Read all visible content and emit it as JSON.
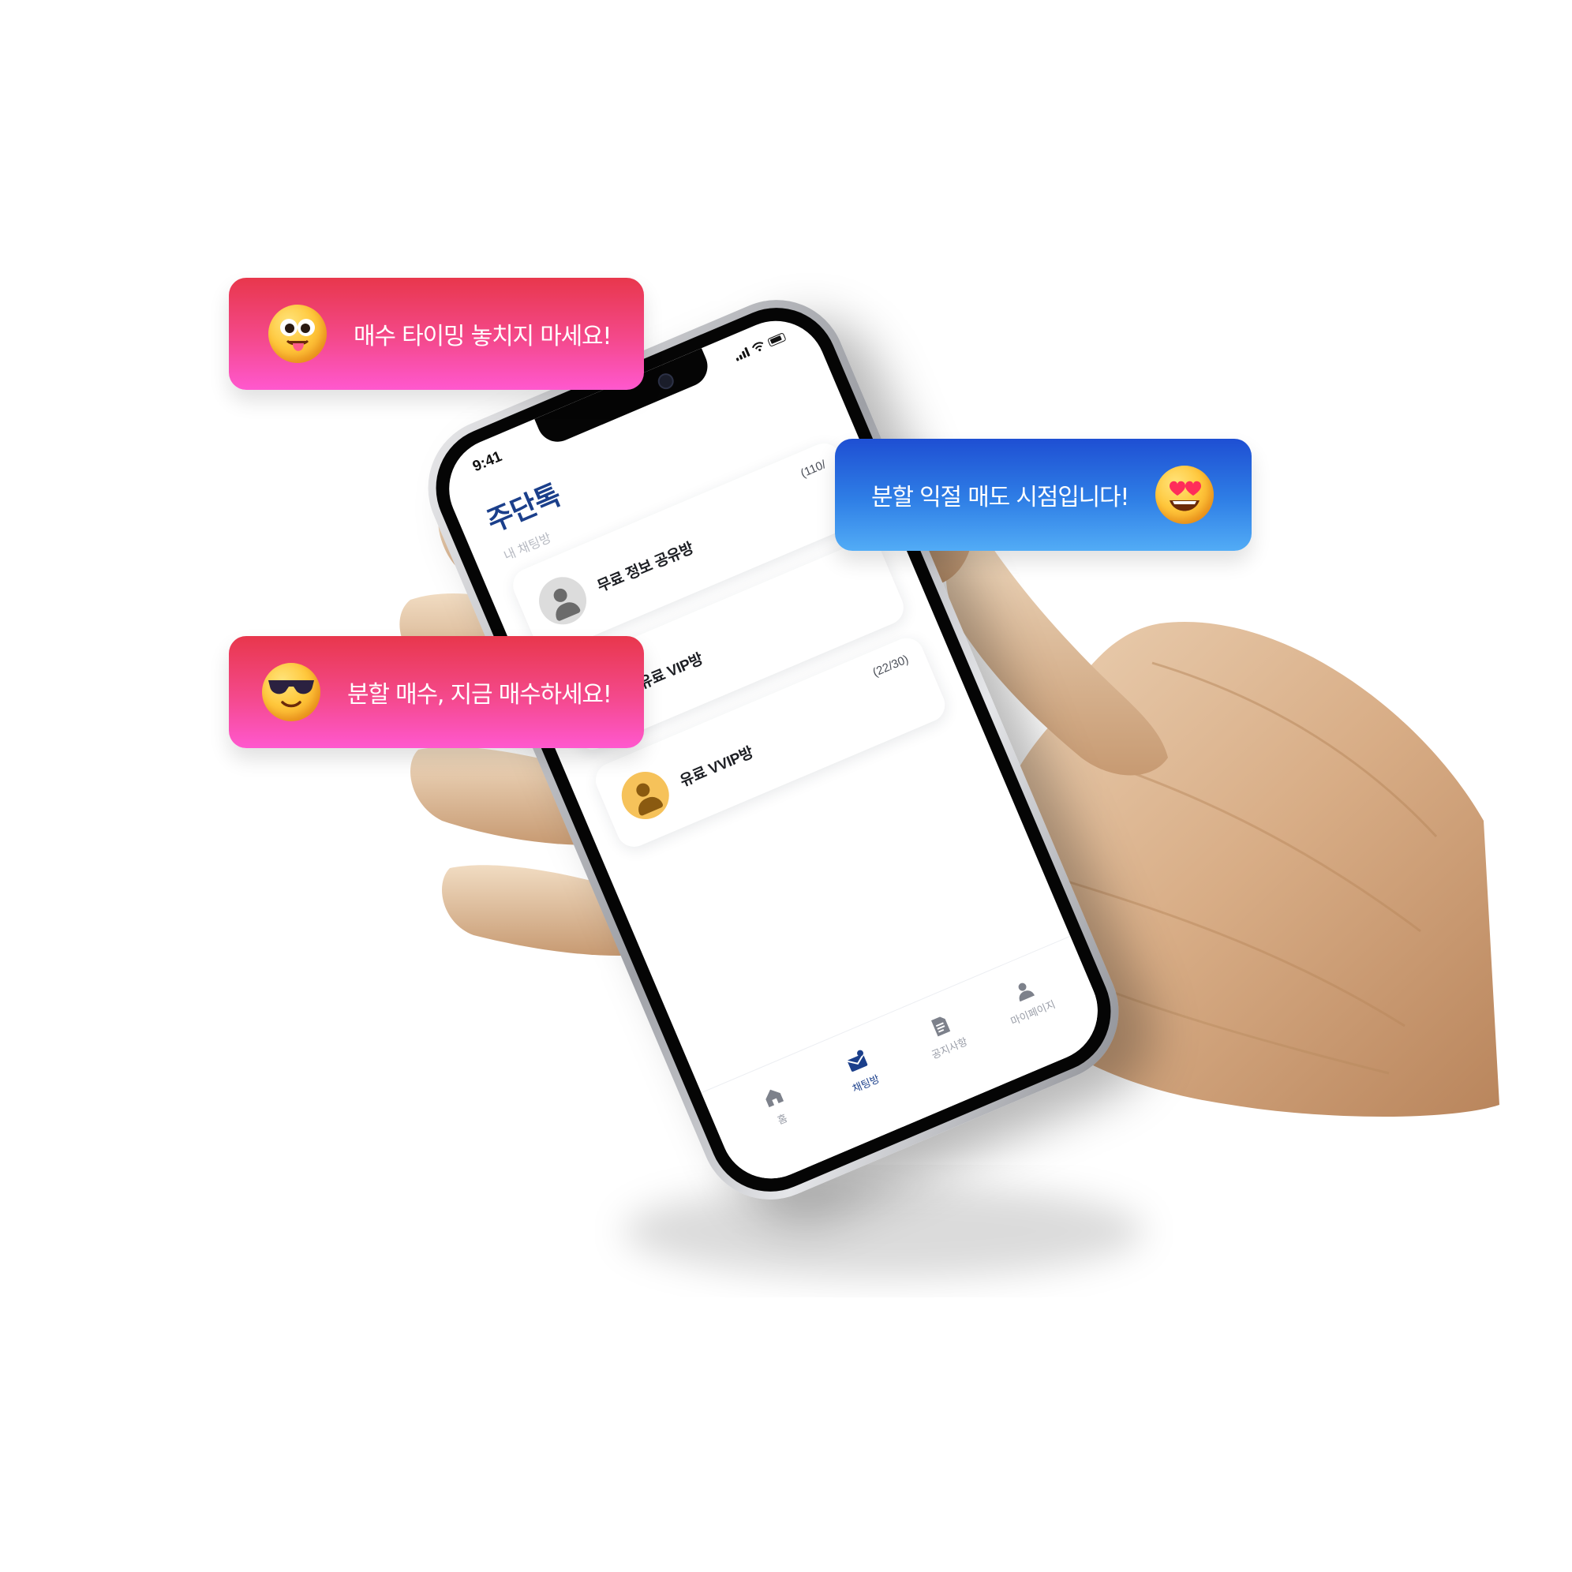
{
  "phone": {
    "status": {
      "time": "9:41"
    },
    "app_title": "주단톡",
    "section_label": "내 채팅방",
    "rooms": [
      {
        "name": "무료 정보 공유방",
        "count": "(110/",
        "avatar_color": "#dcdcdc",
        "icon_color": "#6b6b6b"
      },
      {
        "name": "유료 VIP방",
        "count": "",
        "avatar_color": "#7f9fd9",
        "icon_color": "#2a4f9e"
      },
      {
        "name": "유료 VVIP방",
        "count": "(22/30)",
        "avatar_color": "#f6c25a",
        "icon_color": "#8a5a10"
      }
    ],
    "tabs": [
      {
        "label": "홈",
        "icon": "home-icon",
        "active": false
      },
      {
        "label": "채팅방",
        "icon": "chat-icon",
        "active": true
      },
      {
        "label": "공지사항",
        "icon": "notice-icon",
        "active": false
      },
      {
        "label": "마이페이지",
        "icon": "profile-icon",
        "active": false
      }
    ]
  },
  "bubbles": [
    {
      "text": "매수 타이밍 놓치지 마세요!",
      "emoji": "tongue-out-emoji",
      "style": "pink"
    },
    {
      "text": "분할 익절 매도 시점입니다!",
      "emoji": "heart-eyes-emoji",
      "style": "blue"
    },
    {
      "text": "분할 매수, 지금 매수하세요!",
      "emoji": "sunglasses-emoji",
      "style": "pink"
    }
  ],
  "colors": {
    "brand": "#1b3f8b",
    "pink_bubble_top": "#e8374c",
    "pink_bubble_bottom": "#ff58cf",
    "blue_bubble_top": "#1e4fd3",
    "blue_bubble_bottom": "#52acf6",
    "wood": "#d9b08c"
  }
}
